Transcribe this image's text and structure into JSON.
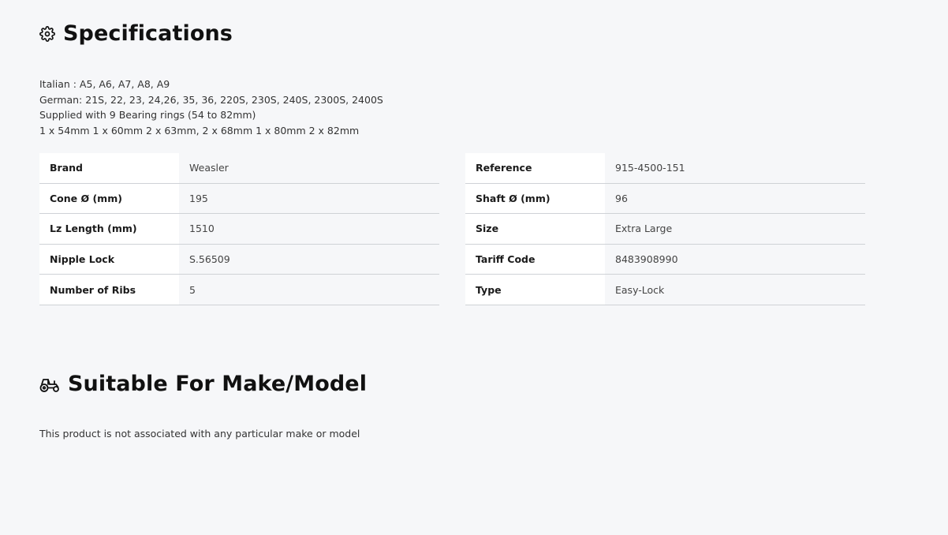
{
  "specifications": {
    "title": "Specifications",
    "icon": "gear-icon",
    "description": [
      "Italian : A5, A6, A7, A8, A9",
      "German: 21S, 22, 23, 24,26, 35, 36, 220S, 230S, 240S, 2300S, 2400S",
      "Supplied with 9 Bearing rings (54 to 82mm)",
      "1 x 54mm 1 x 60mm 2 x 63mm, 2 x 68mm 1 x 80mm 2 x 82mm"
    ],
    "left_table": [
      {
        "key": "Brand",
        "value": "Weasler"
      },
      {
        "key": "Cone Ø (mm)",
        "value": "195"
      },
      {
        "key": "Lz Length (mm)",
        "value": "1510"
      },
      {
        "key": "Nipple Lock",
        "value": "S.56509"
      },
      {
        "key": "Number of Ribs",
        "value": "5"
      }
    ],
    "right_table": [
      {
        "key": "Reference",
        "value": "915-4500-151"
      },
      {
        "key": "Shaft Ø (mm)",
        "value": "96"
      },
      {
        "key": "Size",
        "value": "Extra Large"
      },
      {
        "key": "Tariff Code",
        "value": "8483908990"
      },
      {
        "key": "Type",
        "value": "Easy-Lock"
      }
    ]
  },
  "make_model": {
    "title": "Suitable For Make/Model",
    "icon": "tractor-icon",
    "note": "This product is not associated with any particular make or model"
  }
}
